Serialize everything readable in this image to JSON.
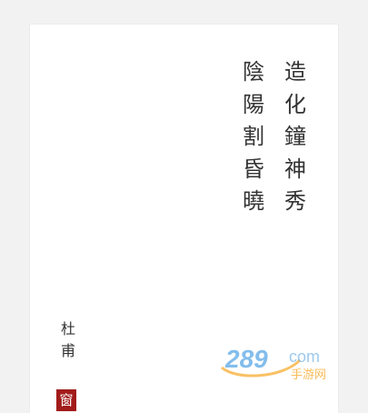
{
  "poem": {
    "columns": [
      [
        "造",
        "化",
        "鐘",
        "神",
        "秀"
      ],
      [
        "陰",
        "陽",
        "割",
        "昏",
        "曉"
      ]
    ]
  },
  "author": [
    "杜",
    "甫"
  ],
  "seal_char": "窗",
  "watermark": {
    "number": "289",
    "domain": "com",
    "subtitle": "手游网"
  },
  "colors": {
    "background": "#f2f2f2",
    "card": "#ffffff",
    "text": "#333333",
    "seal": "#a21b1b",
    "watermark_blue": "#5aa7e6",
    "watermark_orange": "#f6a623"
  }
}
